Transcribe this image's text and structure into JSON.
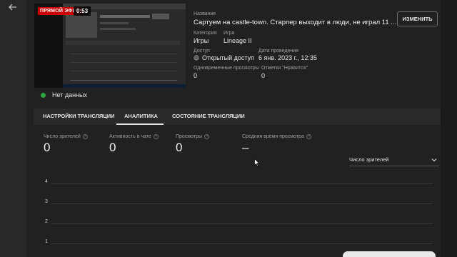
{
  "video": {
    "live_badge": "ПРЯМОЙ ЭФИР",
    "time": "0:53",
    "status_text": "Нет данных"
  },
  "details": {
    "title_label": "Название",
    "title": "Сартуем на castle-town. Старпер выходит в люди, не играл 11 ...",
    "edit_button": "ИЗМЕНИТЬ",
    "category_label": "Категория",
    "category": "Игры",
    "game_label": "Игра",
    "game": "Lineage II",
    "access_label": "Доступ",
    "access": "Открытый доступ",
    "date_label": "Дата проведения",
    "date": "6 янв. 2023 г., 12:35",
    "concurrent_label": "Одновременные просмотры",
    "concurrent": "0",
    "likes_label": "Отметки \"Нравится\"",
    "likes": "0"
  },
  "tabs": [
    {
      "label": "НАСТРОЙКИ ТРАНСЛЯЦИИ"
    },
    {
      "label": "АНАЛИТИКА",
      "active": true
    },
    {
      "label": "СОСТОЯНИЕ ТРАНСЛЯЦИИ"
    }
  ],
  "metrics": [
    {
      "label": "Число зрителей",
      "value": "0"
    },
    {
      "label": "Активность в чате",
      "value": "0"
    },
    {
      "label": "Просмотры",
      "value": "0"
    },
    {
      "label": "Средняя время просмотра",
      "value": "–"
    }
  ],
  "metric_select": {
    "selected": "Число зрителей"
  },
  "chart": {
    "y_ticks": [
      "4",
      "3",
      "2",
      "1"
    ]
  },
  "colors": {
    "live": "#cc0000",
    "status_dot": "#2ba640"
  },
  "icons": [
    "back-arrow-icon",
    "globe-icon",
    "help-icon",
    "chevron-down-icon"
  ]
}
